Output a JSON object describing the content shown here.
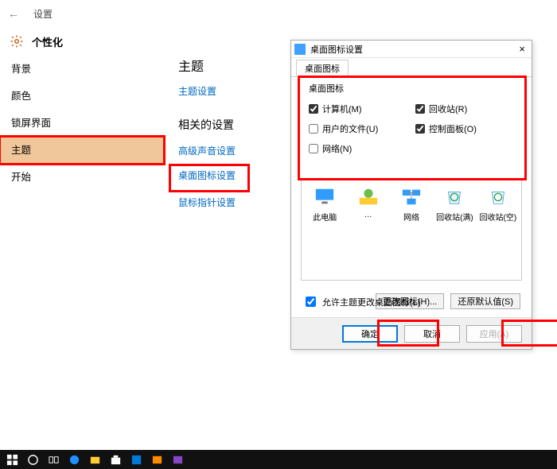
{
  "header": {
    "back_glyph": "←",
    "app_label": "设置",
    "page_title": "个性化"
  },
  "sidebar": {
    "items": [
      {
        "label": "背景"
      },
      {
        "label": "颜色"
      },
      {
        "label": "锁屏界面"
      },
      {
        "label": "主题"
      },
      {
        "label": "开始"
      }
    ],
    "active_index": 3
  },
  "main": {
    "heading_theme": "主题",
    "link_theme_settings": "主题设置",
    "heading_related": "相关的设置",
    "link_adv_sound": "高级声音设置",
    "link_desktop_icons": "桌面图标设置",
    "link_mouse_pointer": "鼠标指针设置"
  },
  "dialog": {
    "title": "桌面图标设置",
    "tab": "桌面图标",
    "fieldset_label": "桌面图标",
    "checks": [
      {
        "label": "计算机(M)",
        "checked": true
      },
      {
        "label": "回收站(R)",
        "checked": true
      },
      {
        "label": "用户的文件(U)",
        "checked": false
      },
      {
        "label": "控制面板(O)",
        "checked": true
      },
      {
        "label": "网络(N)",
        "checked": false
      }
    ],
    "icon_items": [
      {
        "label": "此电脑"
      },
      {
        "label": "…"
      },
      {
        "label": "网络"
      },
      {
        "label": "回收站(满)"
      },
      {
        "label": "回收站(空)"
      }
    ],
    "btn_change_icon": "更改图标(H)...",
    "btn_restore_default": "还原默认值(S)",
    "allow_theme_label": "允许主题更改桌面图标(L)",
    "allow_theme_checked": true,
    "btn_ok": "确定",
    "btn_cancel": "取消",
    "btn_apply": "应用(A)"
  }
}
